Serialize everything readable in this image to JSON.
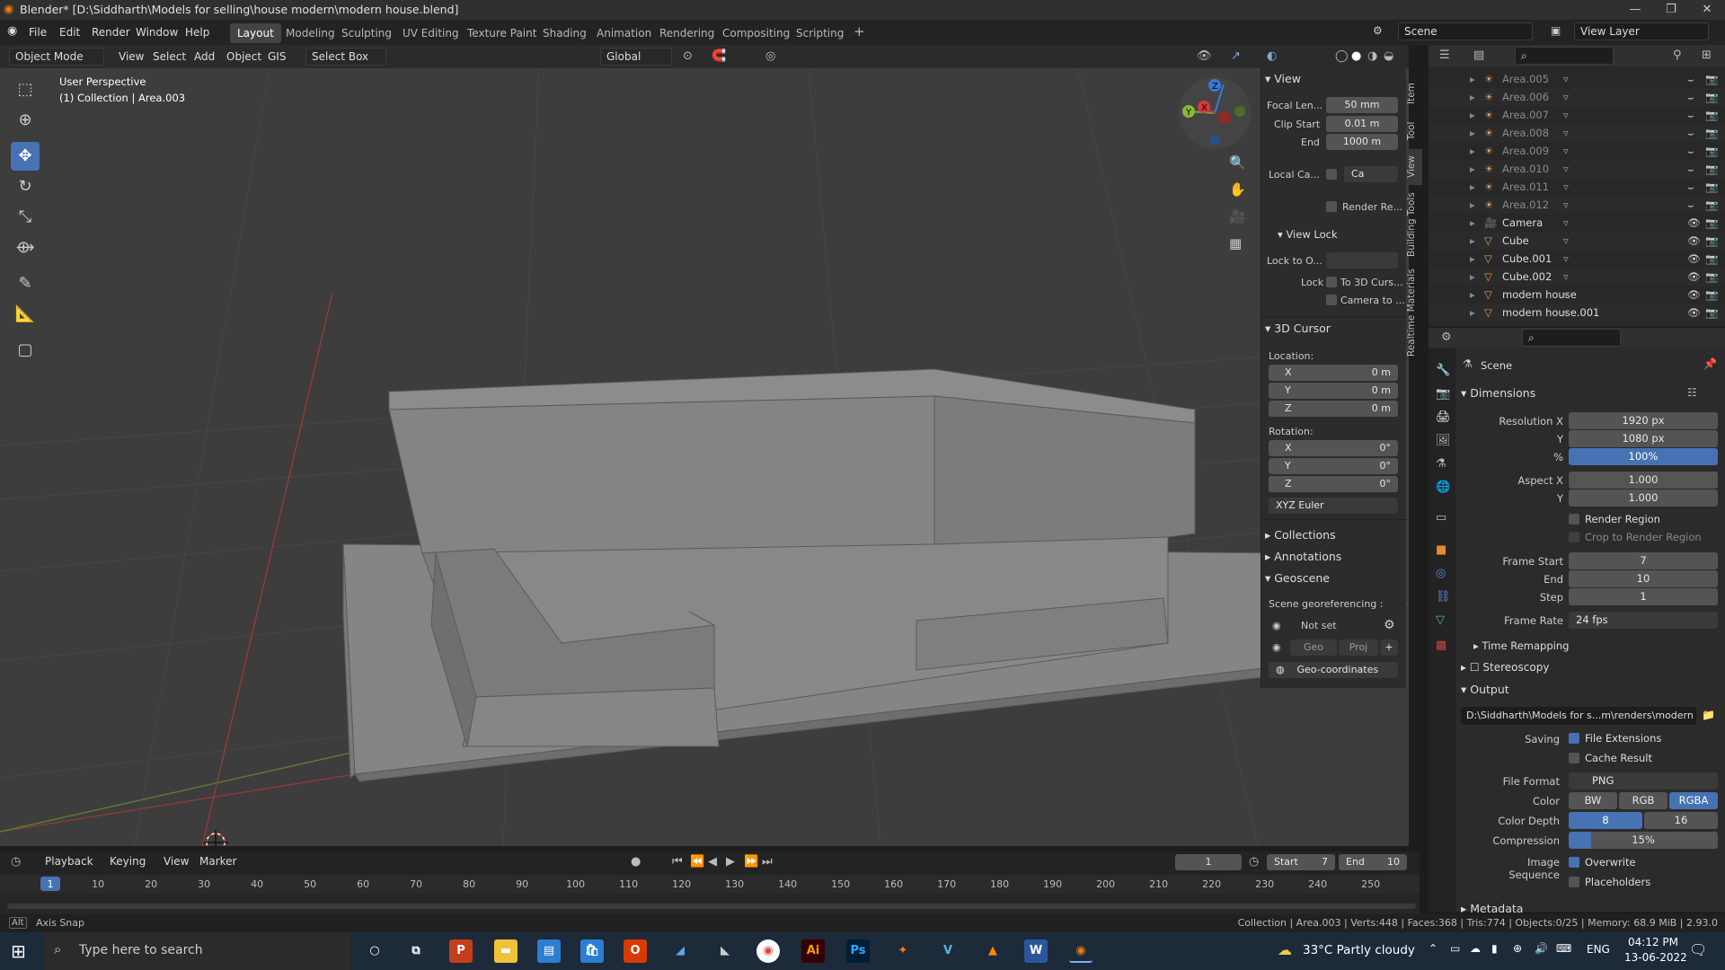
{
  "window": {
    "title": "Blender* [D:\\Siddharth\\Models for selling\\house modern\\modern house.blend]"
  },
  "menus": [
    "File",
    "Edit",
    "Render",
    "Window",
    "Help"
  ],
  "workspaces": [
    "Layout",
    "Modeling",
    "Sculpting",
    "UV Editing",
    "Texture Paint",
    "Shading",
    "Animation",
    "Rendering",
    "Compositing",
    "Scripting"
  ],
  "topright": {
    "scene": "Scene",
    "view_layer": "View Layer"
  },
  "header": {
    "mode": "Object Mode",
    "view": "View",
    "select": "Select",
    "add": "Add",
    "object": "Object",
    "gis": "GIS",
    "select_box": "Select Box",
    "orientation": "Global"
  },
  "viewport": {
    "perspective": "User Perspective",
    "collection": "(1) Collection | Area.003"
  },
  "npanel": {
    "view_title": "View",
    "focal_label": "Focal Len...",
    "focal": "50 mm",
    "clip_start_label": "Clip Start",
    "clip_start": "0.01 m",
    "end_label": "End",
    "clip_end": "1000 m",
    "local_cam_label": "Local Ca...",
    "local_cam_val": "Ca",
    "render_region_label": "Render Re...",
    "view_lock_title": "View Lock",
    "lock_to_label": "Lock to O...",
    "lock_label": "Lock",
    "lock_3d": "To 3D Curs...",
    "lock_cam": "Camera to ...",
    "cursor_title": "3D Cursor",
    "location_label": "Location:",
    "rotation_label": "Rotation:",
    "x": "X",
    "y": "Y",
    "z": "Z",
    "loc_x": "0 m",
    "loc_y": "0 m",
    "loc_z": "0 m",
    "rot_x": "0°",
    "rot_y": "0°",
    "rot_z": "0°",
    "rot_mode": "XYZ Euler",
    "collections": "Collections",
    "annotations": "Annotations",
    "geoscene": "Geoscene",
    "georef": "Scene georeferencing :",
    "not_set": "Not set",
    "geo": "Geo",
    "proj": "Proj",
    "geocoords": "Geo-coordinates",
    "tabs": [
      "Item",
      "Tool",
      "View",
      "Building Tools",
      "Realtime Materials"
    ]
  },
  "outliner": {
    "rows": [
      {
        "name": "Area.005",
        "dim": true,
        "kind": "light"
      },
      {
        "name": "Area.006",
        "dim": true,
        "kind": "light"
      },
      {
        "name": "Area.007",
        "dim": true,
        "kind": "light"
      },
      {
        "name": "Area.008",
        "dim": true,
        "kind": "light"
      },
      {
        "name": "Area.009",
        "dim": true,
        "kind": "light"
      },
      {
        "name": "Area.010",
        "dim": true,
        "kind": "light"
      },
      {
        "name": "Area.011",
        "dim": true,
        "kind": "light"
      },
      {
        "name": "Area.012",
        "dim": true,
        "kind": "light"
      },
      {
        "name": "Camera",
        "dim": false,
        "kind": "camera"
      },
      {
        "name": "Cube",
        "dim": false,
        "kind": "mesh"
      },
      {
        "name": "Cube.001",
        "dim": false,
        "kind": "mesh"
      },
      {
        "name": "Cube.002",
        "dim": false,
        "kind": "mesh"
      },
      {
        "name": "modern house",
        "dim": false,
        "kind": "mesh"
      },
      {
        "name": "modern house.001",
        "dim": false,
        "kind": "mesh"
      }
    ]
  },
  "properties": {
    "scene": "Scene",
    "dimensions": "Dimensions",
    "res_x_label": "Resolution X",
    "res_x": "1920 px",
    "res_y_label": "Y",
    "res_y": "1080 px",
    "pct_label": "%",
    "pct": "100%",
    "aspect_x_label": "Aspect X",
    "aspect_x": "1.000",
    "aspect_y_label": "Y",
    "aspect_y": "1.000",
    "render_region": "Render Region",
    "crop": "Crop to Render Region",
    "frame_start_label": "Frame Start",
    "frame_start": "7",
    "end_label": "End",
    "frame_end": "10",
    "step_label": "Step",
    "step": "1",
    "frame_rate_label": "Frame Rate",
    "frame_rate": "24 fps",
    "time_remap": "Time Remapping",
    "stereoscopy": "Stereoscopy",
    "output": "Output",
    "output_path": "D:\\Siddharth\\Models for s...m\\renders\\modern house",
    "saving_label": "Saving",
    "file_ext": "File Extensions",
    "cache": "Cache Result",
    "file_format_label": "File Format",
    "file_format": "PNG",
    "color_label": "Color",
    "bw": "BW",
    "rgb": "RGB",
    "rgba": "RGBA",
    "depth_label": "Color Depth",
    "d8": "8",
    "d16": "16",
    "compression_label": "Compression",
    "compression": "15%",
    "img_seq_label": "Image Sequence",
    "overwrite": "Overwrite",
    "placeholders": "Placeholders",
    "metadata": "Metadata"
  },
  "timeline": {
    "playback": "Playback",
    "keying": "Keying",
    "view": "View",
    "marker": "Marker",
    "current": "1",
    "start_label": "Start",
    "start": "7",
    "end_label": "End",
    "end": "10",
    "ticks": [
      "1",
      "10",
      "20",
      "30",
      "40",
      "50",
      "60",
      "70",
      "80",
      "90",
      "100",
      "110",
      "120",
      "130",
      "140",
      "150",
      "160",
      "170",
      "180",
      "190",
      "200",
      "210",
      "220",
      "230",
      "240",
      "250"
    ]
  },
  "status": {
    "left": "Axis Snap",
    "right": "Collection | Area.003 | Verts:448 | Faces:368 | Tris:774 | Objects:0/25 | Memory: 68.9 MiB | 2.93.0"
  },
  "taskbar": {
    "search": "Type here to search",
    "weather": "33°C  Partly cloudy",
    "lang": "ENG",
    "time": "04:12 PM",
    "date": "13-06-2022"
  },
  "colors": {
    "accent": "#4772b3",
    "viewport": "#3d3d3d",
    "panel": "#2c2c2c"
  }
}
